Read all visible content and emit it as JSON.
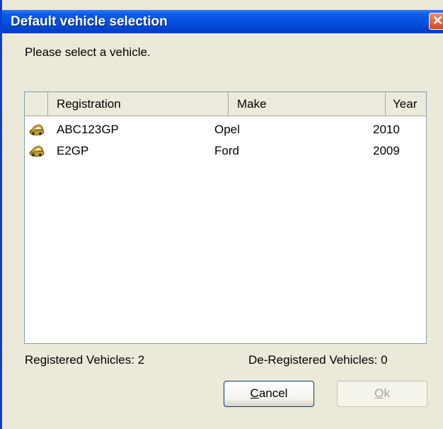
{
  "window": {
    "title": "Default vehicle selection",
    "close_glyph": "✕"
  },
  "prompt": "Please select a vehicle.",
  "table": {
    "columns": [
      "",
      "Registration",
      "Make",
      "Year"
    ],
    "rows": [
      {
        "icon": "car-icon",
        "registration": "ABC123GP",
        "make": "Opel",
        "year": "2010"
      },
      {
        "icon": "car-icon",
        "registration": "E2GP",
        "make": "Ford",
        "year": "2009"
      }
    ]
  },
  "footer": {
    "registered_label": "Registered Vehicles:",
    "registered_count": "2",
    "deregistered_label": "De-Registered Vehicles:",
    "deregistered_count": "0"
  },
  "buttons": {
    "cancel": {
      "mnemonic": "C",
      "rest": "ancel",
      "enabled": true
    },
    "ok": {
      "mnemonic": "O",
      "rest": "k",
      "enabled": false
    }
  },
  "colors": {
    "titlebar": "#0450e0",
    "dialog_bg": "#ece9d8",
    "disabled_text": "#a5a391"
  }
}
